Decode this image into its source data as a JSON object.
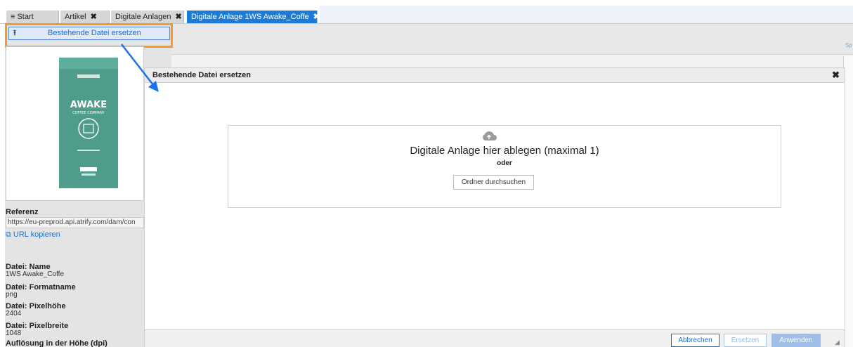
{
  "tabs": [
    {
      "label": "≡ Start",
      "closable": false
    },
    {
      "label": "Artikel",
      "closable": true
    },
    {
      "label": "Digitale Anlagen",
      "closable": true
    },
    {
      "label": "Digitale Anlage 1WS Awake_Coffe",
      "closable": true,
      "active": true
    }
  ],
  "tab_close_glyph": "✖",
  "left_panel": {
    "replace_button_label": "Bestehende Datei ersetzen",
    "replace_icon": "upload-icon",
    "reference_label": "Referenz",
    "reference_url": "https://eu-preprod.api.atrify.com/dam/con",
    "copy_url_label": "URL kopieren",
    "fields": [
      {
        "label": "Datei: Name",
        "value": "1WS Awake_Coffe"
      },
      {
        "label": "Datei: Formatname",
        "value": "png"
      },
      {
        "label": "Datei: Pixelhöhe",
        "value": "2404"
      },
      {
        "label": "Datei: Pixelbreite",
        "value": "1048"
      },
      {
        "label": "Auflösung in der Höhe (dpi)",
        "value": ""
      }
    ],
    "product_text": {
      "brand": "AWAKE",
      "brand_sub": "COFFEE COMPANY"
    }
  },
  "background": {
    "right_hint": "Sp"
  },
  "modal": {
    "title": "Bestehende Datei ersetzen",
    "close_glyph": "✖",
    "drop_text": "Digitale Anlage hier ablegen (maximal 1)",
    "or_text": "oder",
    "browse_label": "Ordner durchsuchen",
    "cancel_label": "Abbrechen",
    "replace_label": "Ersetzen",
    "apply_label": "Anwenden"
  },
  "colors": {
    "accent": "#1d7bd6",
    "highlight": "#f39a2a"
  }
}
